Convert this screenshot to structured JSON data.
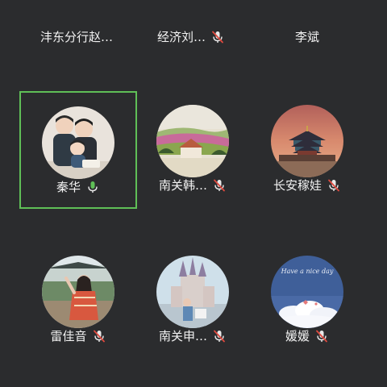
{
  "participants": [
    {
      "name": "沣东分行赵…",
      "mic": "none"
    },
    {
      "name": "经济刘…",
      "mic": "muted"
    },
    {
      "name": "李斌",
      "mic": "none"
    },
    {
      "name": "秦华",
      "mic": "speaking"
    },
    {
      "name": "南关韩…",
      "mic": "muted"
    },
    {
      "name": "长安稼娃",
      "mic": "muted"
    },
    {
      "name": "雷佳音",
      "mic": "muted"
    },
    {
      "name": "南关申…",
      "mic": "muted"
    },
    {
      "name": "媛媛",
      "mic": "muted"
    }
  ],
  "avatar_texts": {
    "nice_day": "Have a nice day"
  },
  "icons": {
    "mic_muted": "mic-muted-icon",
    "mic_speaking": "mic-active-icon"
  },
  "colors": {
    "background": "#2b2c2e",
    "active_border": "#5fbf57",
    "mic_active": "#5fbf57",
    "mic_muted_slash": "#e04a3f"
  }
}
